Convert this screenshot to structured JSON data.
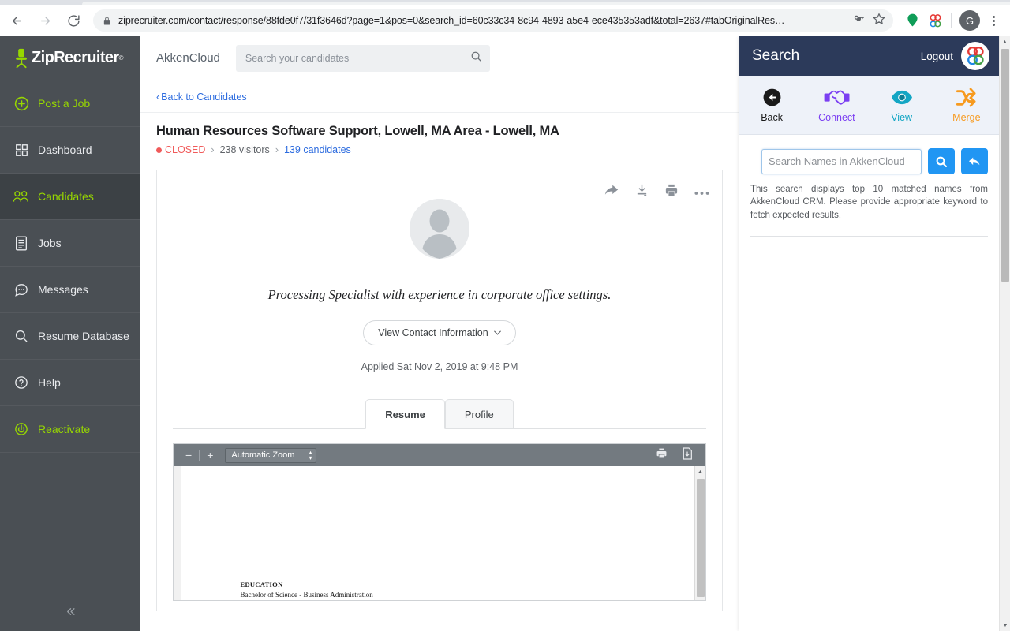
{
  "browser": {
    "back_icon": "arrow-left-icon",
    "forward_icon": "arrow-right-icon",
    "reload_icon": "reload-icon",
    "lock_icon": "lock-icon",
    "url": "ziprecruiter.com/contact/response/88fde0f7/31f3646d?page=1&pos=0&search_id=60c33c34-8c94-4893-a5e4-ece435353adf&total=2637#tabOriginalRes…",
    "key_icon": "key-icon",
    "bookmark_icon": "star-icon",
    "ext_pin_icon": "green-pin-icon",
    "ext_akken_icon": "akkencloud-icon",
    "profile_initial": "G",
    "menu_icon": "three-dot-menu-icon"
  },
  "sidebar": {
    "logo": "ZipRecruiter",
    "logo_tm": "®",
    "collapse_icon": "double-chevron-left-icon",
    "items": [
      {
        "label": "Post a Job",
        "icon": "plus-circle-icon",
        "active": false,
        "accent": true
      },
      {
        "label": "Dashboard",
        "icon": "grid-icon",
        "active": false,
        "accent": false
      },
      {
        "label": "Candidates",
        "icon": "people-icon",
        "active": true,
        "accent": true
      },
      {
        "label": "Jobs",
        "icon": "document-icon",
        "active": false,
        "accent": false
      },
      {
        "label": "Messages",
        "icon": "chat-icon",
        "active": false,
        "accent": false
      },
      {
        "label": "Resume Database",
        "icon": "search-icon",
        "active": false,
        "accent": false
      },
      {
        "label": "Help",
        "icon": "question-icon",
        "active": false,
        "accent": false
      },
      {
        "label": "Reactivate",
        "icon": "power-icon",
        "active": false,
        "accent": true
      }
    ]
  },
  "main": {
    "brand": "AkkenCloud",
    "search_placeholder": "Search your candidates",
    "search_value": "",
    "search_icon": "search-icon",
    "back_link": "Back to Candidates",
    "back_chevron": "chevron-left-icon",
    "job_title": "Human Resources Software Support, Lowell, MA Area - Lowell, MA",
    "status": "CLOSED",
    "visitors": "238 visitors",
    "candidates": "139 candidates",
    "card": {
      "share_icon": "share-arrow-icon",
      "download_icon": "download-icon",
      "print_icon": "print-icon",
      "more_icon": "more-horizontal-icon",
      "avatar_icon": "user-avatar-placeholder",
      "headline": "Processing Specialist with experience in corporate office settings.",
      "contact_button": "View Contact Information",
      "contact_chevron": "chevron-down-icon",
      "applied": "Applied Sat Nov 2, 2019 at 9:48 PM",
      "tabs": [
        {
          "label": "Resume",
          "active": true
        },
        {
          "label": "Profile",
          "active": false
        }
      ]
    },
    "pdf": {
      "zoom_out_icon": "minus-icon",
      "zoom_in_icon": "plus-icon",
      "zoom_level": "Automatic Zoom",
      "zoom_spinner_icon": "updown-spinner-icon",
      "print_icon": "print-icon",
      "download_icon": "save-download-icon",
      "doc_heading": "EDUCATION",
      "doc_line": "Bachelor of Science - Business Administration",
      "scroll_up_icon": "triangle-up-icon"
    }
  },
  "extension": {
    "title": "Search",
    "logout": "Logout",
    "logo_icon": "akkencloud-logo-icon",
    "actions": [
      {
        "label": "Back",
        "icon": "back-circle-icon",
        "color": "#1a1a1a"
      },
      {
        "label": "Connect",
        "icon": "handshake-icon",
        "color": "#7b3ff2"
      },
      {
        "label": "View",
        "icon": "eye-icon",
        "color": "#13a6c4"
      },
      {
        "label": "Merge",
        "icon": "shuffle-icon",
        "color": "#f79a1e"
      }
    ],
    "search_placeholder": "Search Names in AkkenCloud",
    "search_value": "",
    "search_button_icon": "search-icon",
    "reset_button_icon": "undo-arrow-icon",
    "help_text": "This search displays top 10 matched names from AkkenCloud CRM. Please provide appropriate keyword to fetch expected results."
  },
  "scrollbar": {
    "up_icon": "triangle-up-icon",
    "down_icon": "triangle-down-icon"
  },
  "colors": {
    "sidebar_bg": "#4a4f54",
    "sidebar_accent": "#97d700",
    "link_blue": "#2d6cdf",
    "status_red": "#f05a5a",
    "ext_header": "#2c3a5a",
    "ext_button_blue": "#2196f3"
  }
}
